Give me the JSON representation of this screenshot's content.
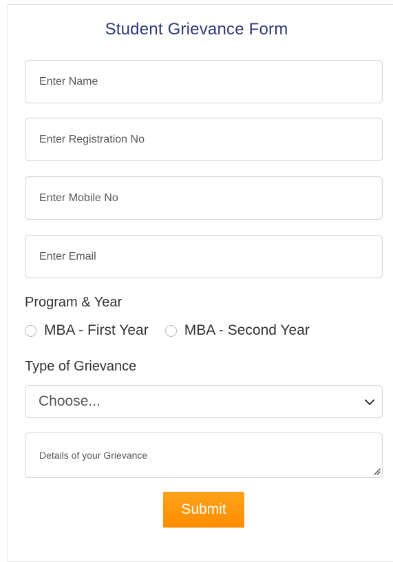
{
  "form": {
    "title": "Student Grievance Form",
    "name_placeholder": "Enter Name",
    "registration_placeholder": "Enter Registration No",
    "mobile_placeholder": "Enter Mobile No",
    "email_placeholder": "Enter Email",
    "program_label": "Program & Year",
    "program_options": [
      "MBA - First Year",
      "MBA - Second Year"
    ],
    "grievance_type_label": "Type of Grievance",
    "grievance_type_selected": "Choose...",
    "details_placeholder": "Details of your Grievance",
    "submit_label": "Submit"
  },
  "colors": {
    "title": "#2f3778",
    "submit_button": "#ff9400",
    "border": "#ced4da"
  }
}
